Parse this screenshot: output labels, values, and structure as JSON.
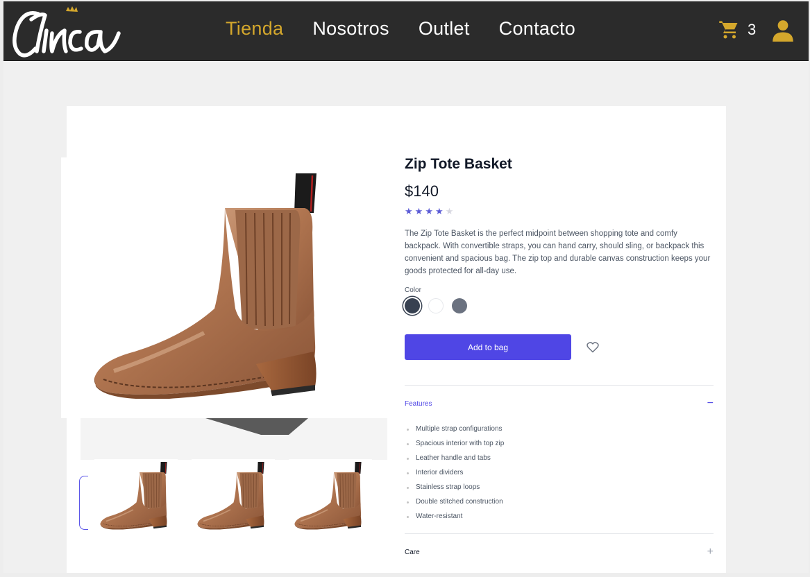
{
  "header": {
    "logo_text": "Cinica",
    "nav": [
      {
        "label": "Tienda",
        "active": true
      },
      {
        "label": "Nosotros",
        "active": false
      },
      {
        "label": "Outlet",
        "active": false
      },
      {
        "label": "Contacto",
        "active": false
      }
    ],
    "cart_count": "3",
    "icons": {
      "cart": "cart-icon",
      "user": "user-icon"
    },
    "accent_color": "#d4a72c"
  },
  "product": {
    "title": "Zip Tote Basket",
    "price": "$140",
    "rating": 4,
    "rating_max": 5,
    "description": "The Zip Tote Basket is the perfect midpoint between shopping tote and comfy backpack. With convertible straps, you can hand carry, should sling, or backpack this convenient and spacious bag. The zip top and durable canvas construction keeps your goods protected for all-day use.",
    "color_label": "Color",
    "colors": [
      "#374151",
      "#ffffff",
      "#6b7280"
    ],
    "selected_color": 0,
    "add_to_bag_label": "Add to bag",
    "button_color": "#4f46e5"
  },
  "accordion": {
    "features_title": "Features",
    "features_toggle": "−",
    "features": [
      "Multiple strap configurations",
      "Spacious interior with top zip",
      "Leather handle and tabs",
      "Interior dividers",
      "Stainless strap loops",
      "Double stitched construction",
      "Water-resistant"
    ],
    "care_title": "Care",
    "care_toggle": "+"
  }
}
